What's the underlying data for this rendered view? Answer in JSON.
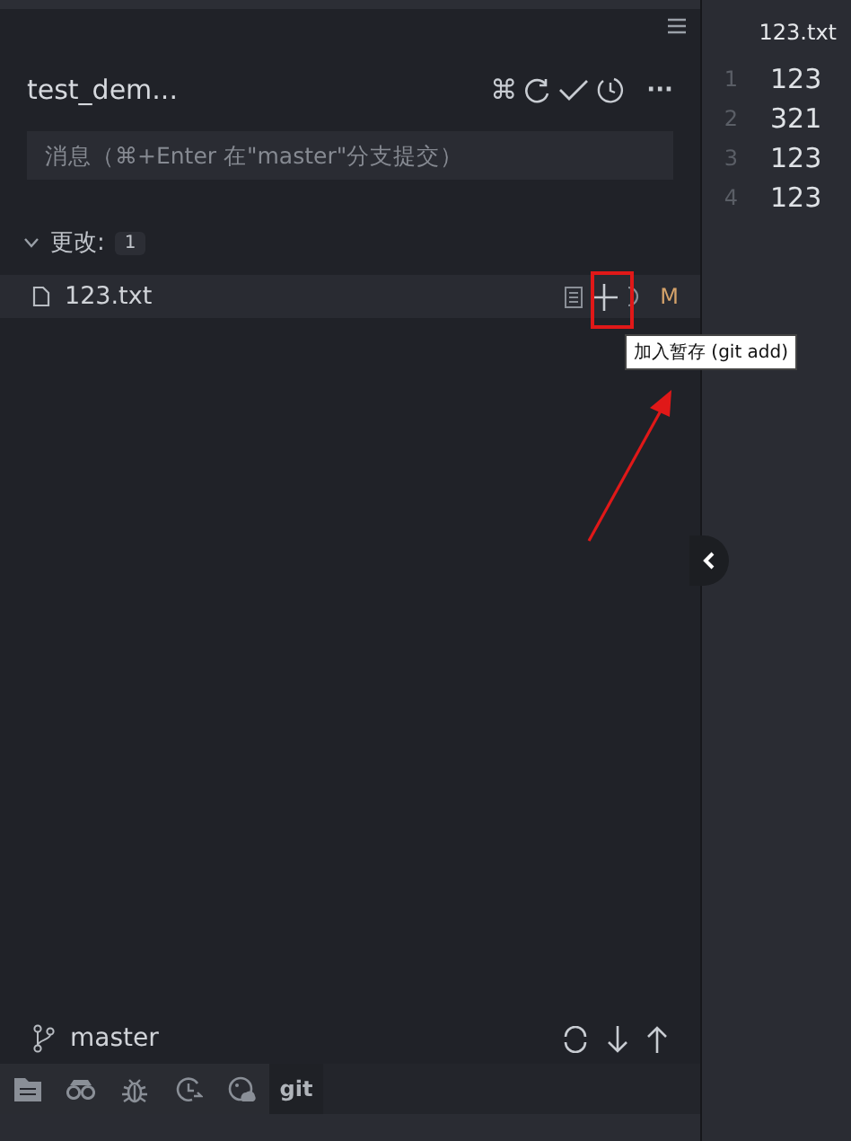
{
  "repo": {
    "title": "test_dem...",
    "actions": [
      {
        "kind": "command",
        "label": "⌘"
      },
      {
        "kind": "refresh"
      },
      {
        "kind": "commit"
      },
      {
        "kind": "history"
      },
      {
        "kind": "more",
        "label": "···"
      }
    ]
  },
  "commit_message": {
    "placeholder": "消息（⌘+Enter 在\"master\"分支提交）"
  },
  "changes": {
    "label": "更改:",
    "count": "1",
    "expanded": true,
    "files": [
      {
        "name": "123.txt",
        "status": "M",
        "tooltip": "加入暂存 (git add)"
      }
    ]
  },
  "branch": {
    "name": "master"
  },
  "bottom_tabs": [
    {
      "kind": "files",
      "selected": false
    },
    {
      "kind": "search",
      "selected": false
    },
    {
      "kind": "debug",
      "selected": false
    },
    {
      "kind": "history",
      "selected": false
    },
    {
      "kind": "remote",
      "selected": false
    },
    {
      "kind": "git",
      "label": "git",
      "selected": true
    }
  ],
  "editor": {
    "tab": "123.txt",
    "lines": [
      {
        "number": "1",
        "text": "123"
      },
      {
        "number": "2",
        "text": "321"
      },
      {
        "number": "3",
        "text": "123"
      },
      {
        "number": "4",
        "text": "123"
      }
    ]
  }
}
